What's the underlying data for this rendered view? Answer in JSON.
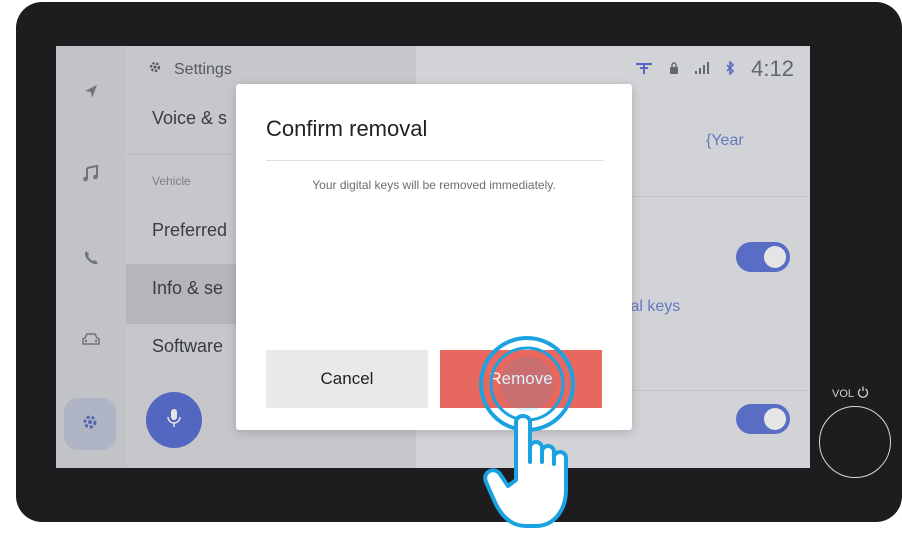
{
  "header": {
    "title": "Settings",
    "time": "4:12"
  },
  "menu": {
    "items": [
      {
        "label": "Voice & s"
      },
      {
        "label": "Preferred"
      },
      {
        "label": "Info & se"
      },
      {
        "label": "Software"
      }
    ],
    "section_label": "Vehicle"
  },
  "content": {
    "year_text": "{Year",
    "keys_text": "tal keys"
  },
  "dialog": {
    "title": "Confirm removal",
    "message": "Your digital keys will be removed immediately.",
    "cancel_label": "Cancel",
    "remove_label": "Remove"
  },
  "hardware": {
    "vol_label": "VOL"
  },
  "icons": {
    "rail": [
      "navigation-icon",
      "music-icon",
      "phone-icon",
      "car-icon",
      "gear-icon"
    ],
    "status": [
      "wifi-hotspot-icon",
      "lock-icon",
      "signal-icon",
      "bluetooth-icon"
    ]
  },
  "colors": {
    "accent": "#5f77d8",
    "destructive": "#e8675e",
    "touch_highlight": "#1aa3e0"
  }
}
